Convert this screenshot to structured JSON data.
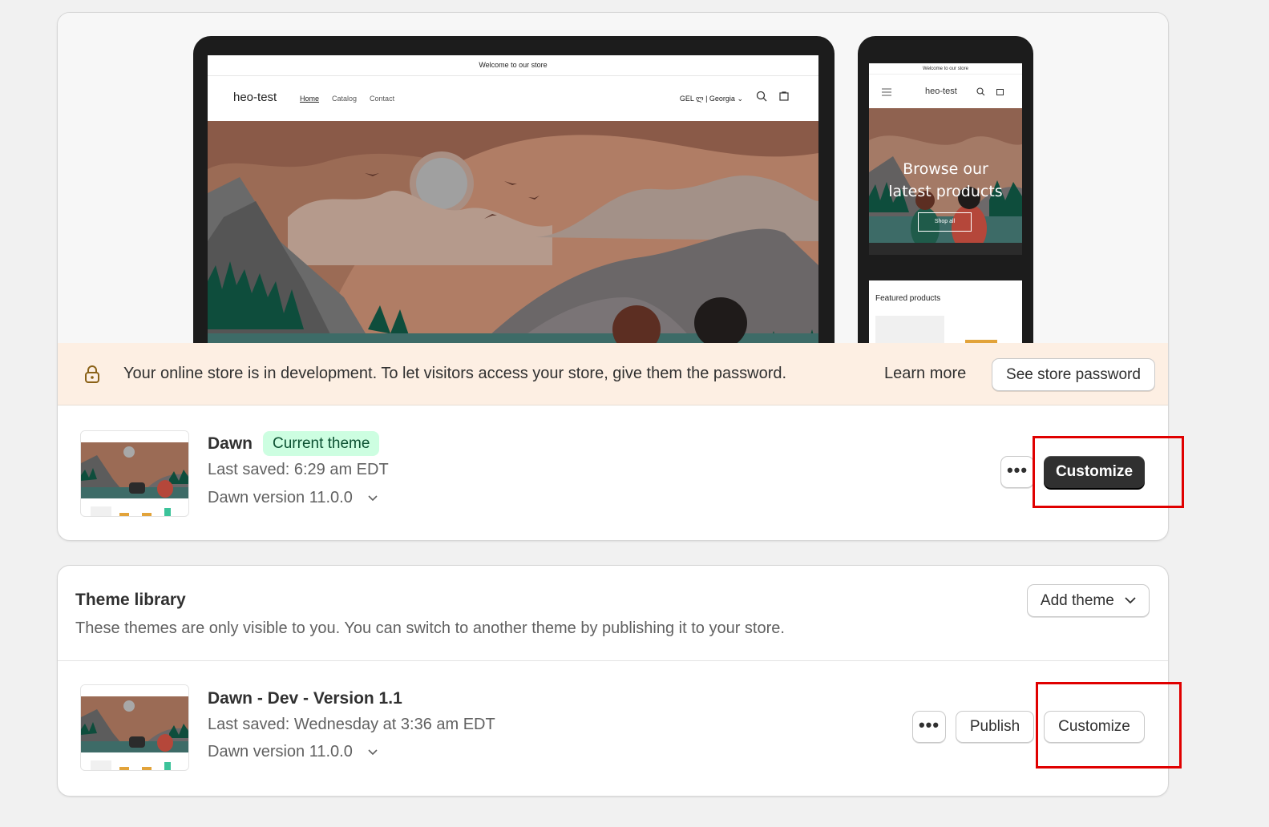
{
  "preview": {
    "desktop": {
      "announcement": "Welcome to our store",
      "logo": "heo-test",
      "nav": [
        "Home",
        "Catalog",
        "Contact"
      ],
      "locale": "GEL ლ | Georgia"
    },
    "mobile": {
      "announcement": "Welcome to our store",
      "logo": "heo-test",
      "hero_line1": "Browse our",
      "hero_line2": "latest products",
      "shop_all": "Shop all",
      "featured": "Featured products"
    }
  },
  "banner": {
    "text": "Your online store is in development. To let visitors access your store, give them the password.",
    "learn_more": "Learn more",
    "button": "See store password",
    "icon": "lock-icon"
  },
  "current_theme": {
    "name": "Dawn",
    "badge": "Current theme",
    "last_saved": "Last saved: 6:29 am EDT",
    "version": "Dawn version 11.0.0",
    "more_label": "•••",
    "customize": "Customize"
  },
  "library": {
    "title": "Theme library",
    "description": "These themes are only visible to you. You can switch to another theme by publishing it to your store.",
    "add_theme": "Add theme",
    "themes": [
      {
        "name": "Dawn - Dev - Version 1.1",
        "last_saved": "Last saved: Wednesday at 3:36 am EDT",
        "version": "Dawn version 11.0.0",
        "more_label": "•••",
        "publish": "Publish",
        "customize": "Customize"
      }
    ]
  },
  "colors": {
    "banner_bg": "#fdefe3",
    "badge_bg": "#cdfee1",
    "badge_text": "#0c5132",
    "primary_button": "#303030",
    "highlight": "#e00000"
  }
}
